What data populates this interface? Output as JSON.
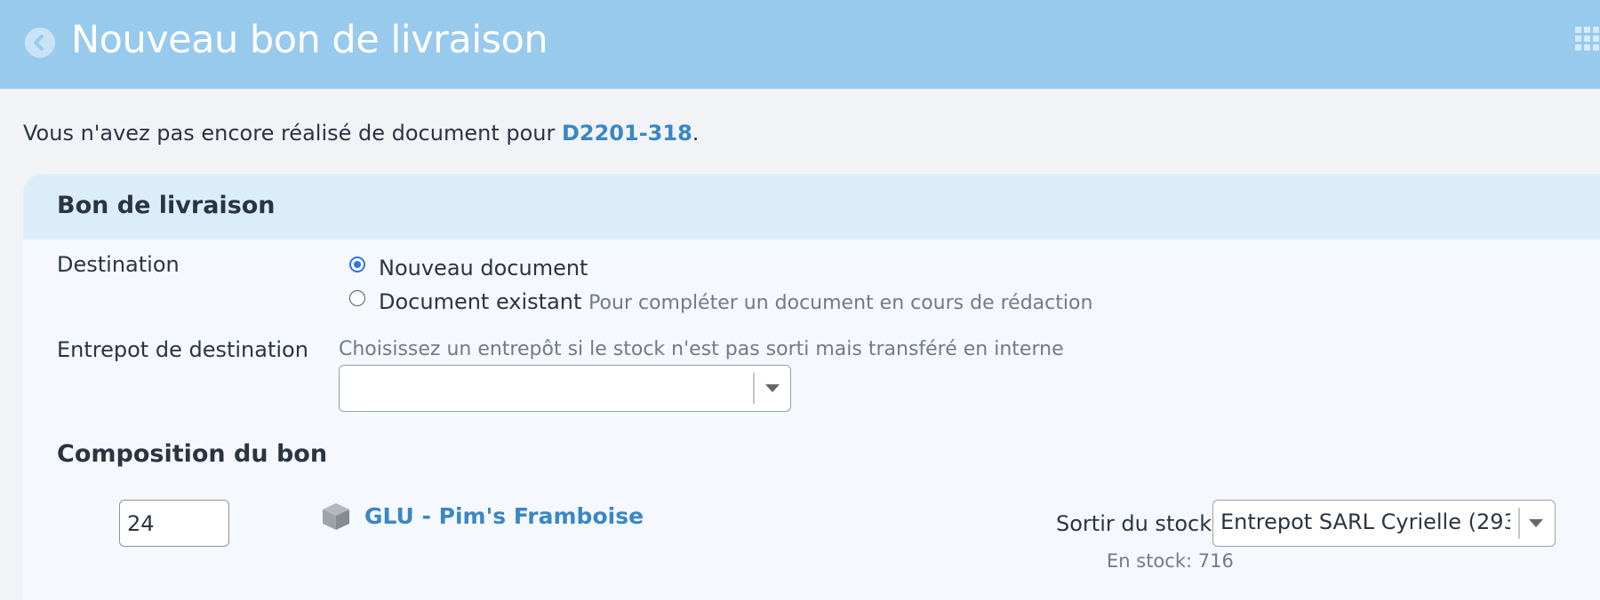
{
  "header": {
    "title": "Nouveau bon de livraison",
    "back_icon": "back-arrow-circle-icon",
    "apps_icon": "grid-apps-icon"
  },
  "notice": {
    "text_before": "Vous n'avez pas encore réalisé de document pour ",
    "link": "D2201-318",
    "text_after": "."
  },
  "form": {
    "card_title": "Bon de livraison",
    "destination": {
      "label": "Destination",
      "options": [
        {
          "label": "Nouveau document",
          "hint": "",
          "checked": true
        },
        {
          "label": "Document existant",
          "hint": "Pour compléter un document en cours de rédaction",
          "checked": false
        }
      ]
    },
    "warehouse": {
      "label": "Entrepot de destination",
      "help": "Choisissez un entrepôt si le stock n'est pas sorti mais transféré en interne",
      "value": ""
    },
    "composition": {
      "title": "Composition du bon",
      "lines": [
        {
          "quantity": "24",
          "product_icon": "box-icon",
          "product": "GLU - Pim's Framboise",
          "stock_label": "Sortir du stock",
          "stock_value": "Entrepot SARL Cyrielle (293",
          "stock_info": "En stock: 716"
        }
      ]
    }
  },
  "colors": {
    "header_bg": "#98caee",
    "card_header_bg": "#dcedfa",
    "link": "#3a87c6",
    "radio_checked": "#2f73e6"
  }
}
